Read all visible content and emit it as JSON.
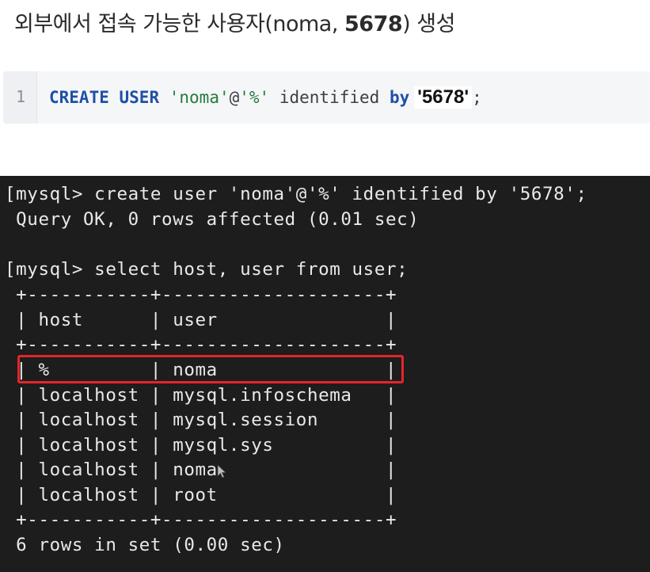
{
  "heading": {
    "text_before": "외부에서 접속 가능한 사용자(noma, ",
    "password": "5678",
    "text_after": ") 생성"
  },
  "code_block": {
    "line_number": "1",
    "kw_create": "CREATE",
    "kw_user": "USER",
    "user_literal": "'noma'",
    "at_sign": "@",
    "host_literal": "'%'",
    "identified": "identified",
    "kw_by": "by",
    "password_literal": "'5678'",
    "semicolon": ";"
  },
  "terminal": {
    "lines": [
      "[mysql> create user 'noma'@'%' identified by '5678';",
      " Query OK, 0 rows affected (0.01 sec)",
      "",
      "[mysql> select host, user from user;",
      " +-----------+--------------------+",
      " | host      | user               |",
      " +-----------+--------------------+",
      " | %         | noma               |",
      " | localhost | mysql.infoschema   |",
      " | localhost | mysql.session      |",
      " | localhost | mysql.sys          |",
      " | localhost | noma               |",
      " | localhost | root               |",
      " +-----------+--------------------+",
      " 6 rows in set (0.00 sec)"
    ],
    "highlight_color": "#e3262c"
  }
}
